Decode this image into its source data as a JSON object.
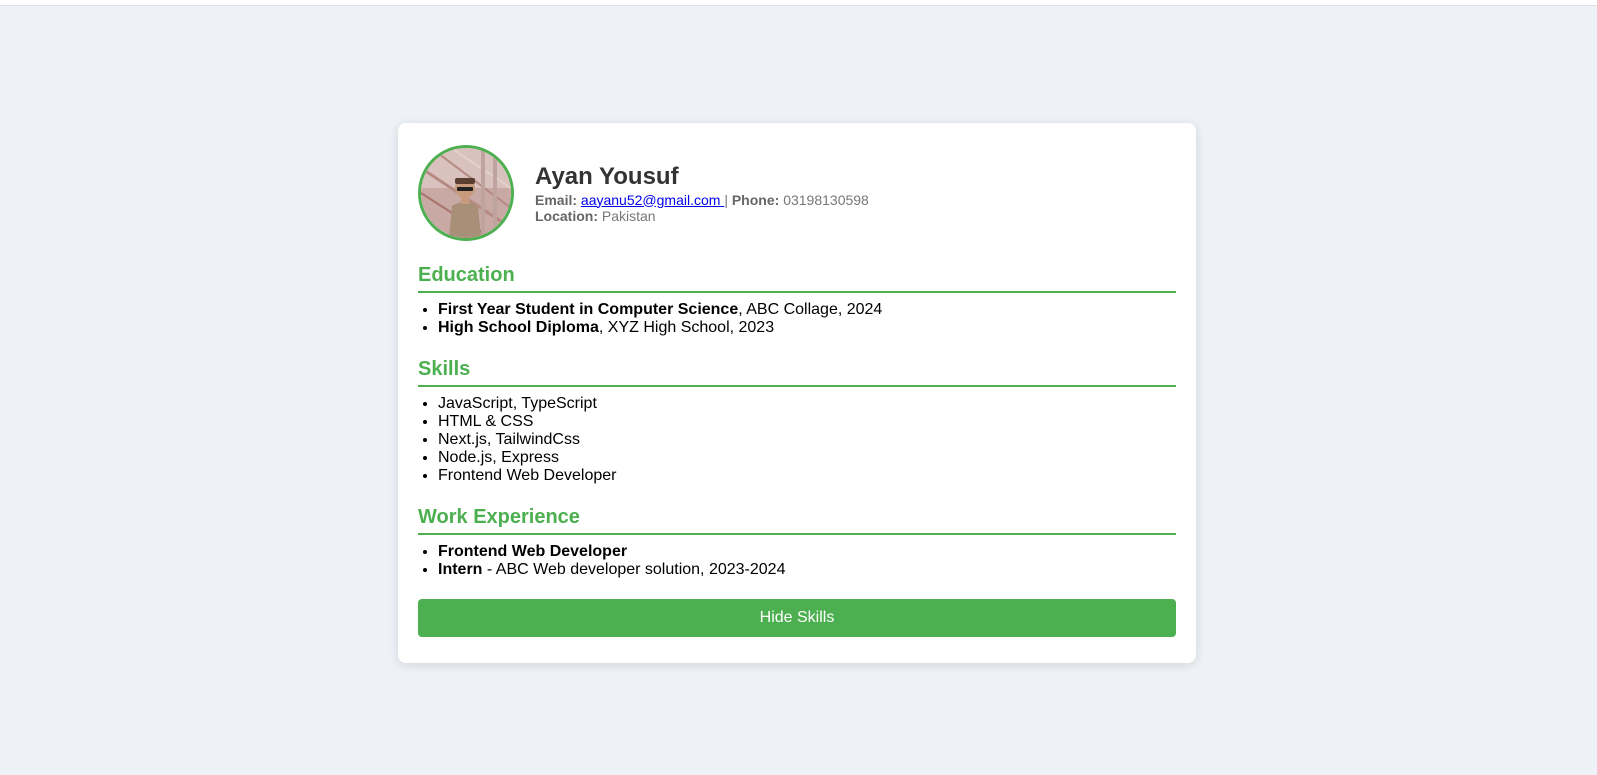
{
  "profile": {
    "name": "Ayan Yousuf",
    "email_label": "Email:",
    "email": "aayanu52@gmail.com",
    "separator": "|",
    "phone_label": "Phone:",
    "phone": "03198130598",
    "location_label": "Location:",
    "location": "Pakistan"
  },
  "education": {
    "title": "Education",
    "items": [
      {
        "bold": "First Year Student in Computer Science",
        "rest": ", ABC Collage, 2024"
      },
      {
        "bold": "High School Diploma",
        "rest": ", XYZ High School, 2023"
      }
    ]
  },
  "skills": {
    "title": "Skills",
    "items": [
      "JavaScript, TypeScript",
      "HTML & CSS",
      "Next.js, TailwindCss",
      "Node.js, Express",
      "Frontend Web Developer"
    ]
  },
  "work": {
    "title": "Work Experience",
    "items": [
      {
        "bold": "Frontend Web Developer",
        "rest": ""
      },
      {
        "bold": "Intern",
        "rest": " - ABC Web developer solution, 2023-2024"
      }
    ]
  },
  "button": {
    "label": "Hide Skills"
  },
  "colors": {
    "accent": "#4caf50",
    "background": "#eef2f7",
    "card": "#ffffff",
    "name": "#333333",
    "link": "#0000ee"
  },
  "icons": {
    "avatar": "profile-photo"
  }
}
